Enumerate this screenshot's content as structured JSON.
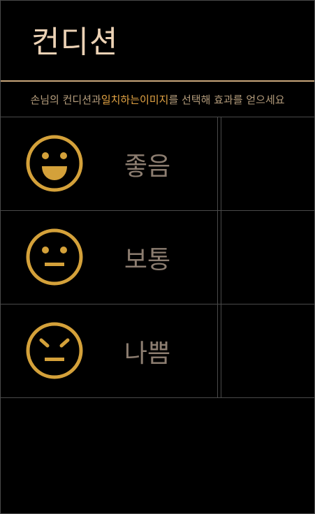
{
  "header": {
    "title": "컨디션"
  },
  "subtitle": {
    "part1": "손님의 컨디션과 ",
    "highlight1": "일치하는",
    "part2": " ",
    "highlight2": "이미지",
    "part3": "를 선택해 효과를 얻으세요"
  },
  "conditions": [
    {
      "label": "좋음",
      "icon": "happy-face-icon"
    },
    {
      "label": "보통",
      "icon": "neutral-face-icon"
    },
    {
      "label": "나쁨",
      "icon": "angry-face-icon"
    }
  ],
  "colors": {
    "background": "#000000",
    "accent_gold": "#d4a13a",
    "title": "#ecd2b5",
    "label": "#8c7d70",
    "highlight": "#e3a444",
    "border": "#4a4a4a",
    "header_rule": "#c9a77b"
  }
}
